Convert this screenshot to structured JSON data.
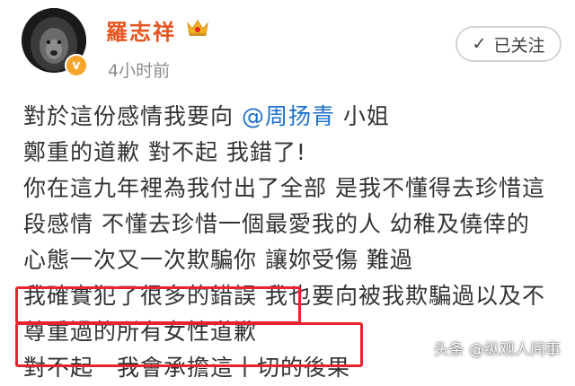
{
  "profile": {
    "username": "羅志祥",
    "time": "4小时前",
    "verified_badge": "v",
    "avatar_icon": "lion-avatar",
    "crown_icon": "crown-icon"
  },
  "follow_button": {
    "check": "✓",
    "label": "已关注"
  },
  "post": {
    "line1_before": "對於這份感情我要向 ",
    "mention": "@周扬青",
    "line1_after": " 小姐",
    "line2": "鄭重的道歉 對不起 我錯了!",
    "line3": "你在這九年裡為我付出了全部 是我不懂得去珍惜這",
    "line4": "段感情 不懂去珍惜一個最愛我的人 幼稚及僥倖的",
    "line5": "心態一次又一次欺騙你 讓妳受傷 難過",
    "line6": "我確實犯了很多的錯誤 我也要向被我欺騙過以及不",
    "line7": "尊重過的所有女性道歉",
    "line8": "對不起　我會承擔這丨切的後果"
  },
  "watermark": "头条 @纵观人间事",
  "colors": {
    "username": "#e8541e",
    "mention": "#1e6fc8",
    "highlight_box": "#e8232f",
    "text": "#333333"
  }
}
